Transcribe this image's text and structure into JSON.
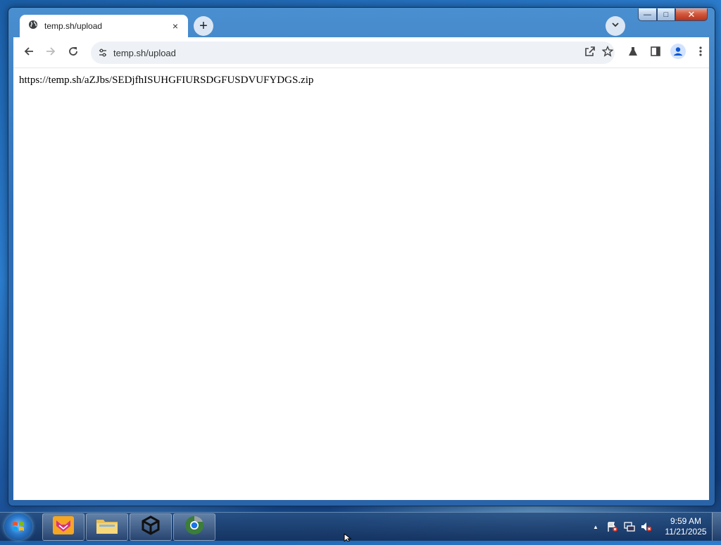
{
  "browser": {
    "tab": {
      "title": "temp.sh/upload",
      "close_glyph": "×"
    },
    "new_tab_glyph": "+",
    "omnibox": {
      "url": "temp.sh/upload"
    },
    "icons": [
      "globe-icon",
      "back-icon",
      "forward-icon",
      "reload-icon",
      "site-info-icon",
      "share-icon",
      "star-icon",
      "labs-icon",
      "side-panel-icon",
      "profile-icon",
      "menu-icon",
      "tab-search-icon"
    ]
  },
  "window_controls": {
    "minimize": "—",
    "maximize": "□",
    "close": "✕"
  },
  "page": {
    "body_text": "https://temp.sh/aZJbs/SEDjfhISUHGFIURSDGFUSDVUFYDGS.zip"
  },
  "taskbar": {
    "clock": {
      "time": "9:59 AM",
      "date": "11/21/2025"
    },
    "tray_arrow": "▲",
    "apps": [
      "app-1",
      "file-explorer",
      "unity",
      "browser"
    ]
  },
  "colors": {
    "omnibox_bg": "#eef2f7",
    "window_frame": "#2f6fb6",
    "accent": "#1a73e8"
  }
}
